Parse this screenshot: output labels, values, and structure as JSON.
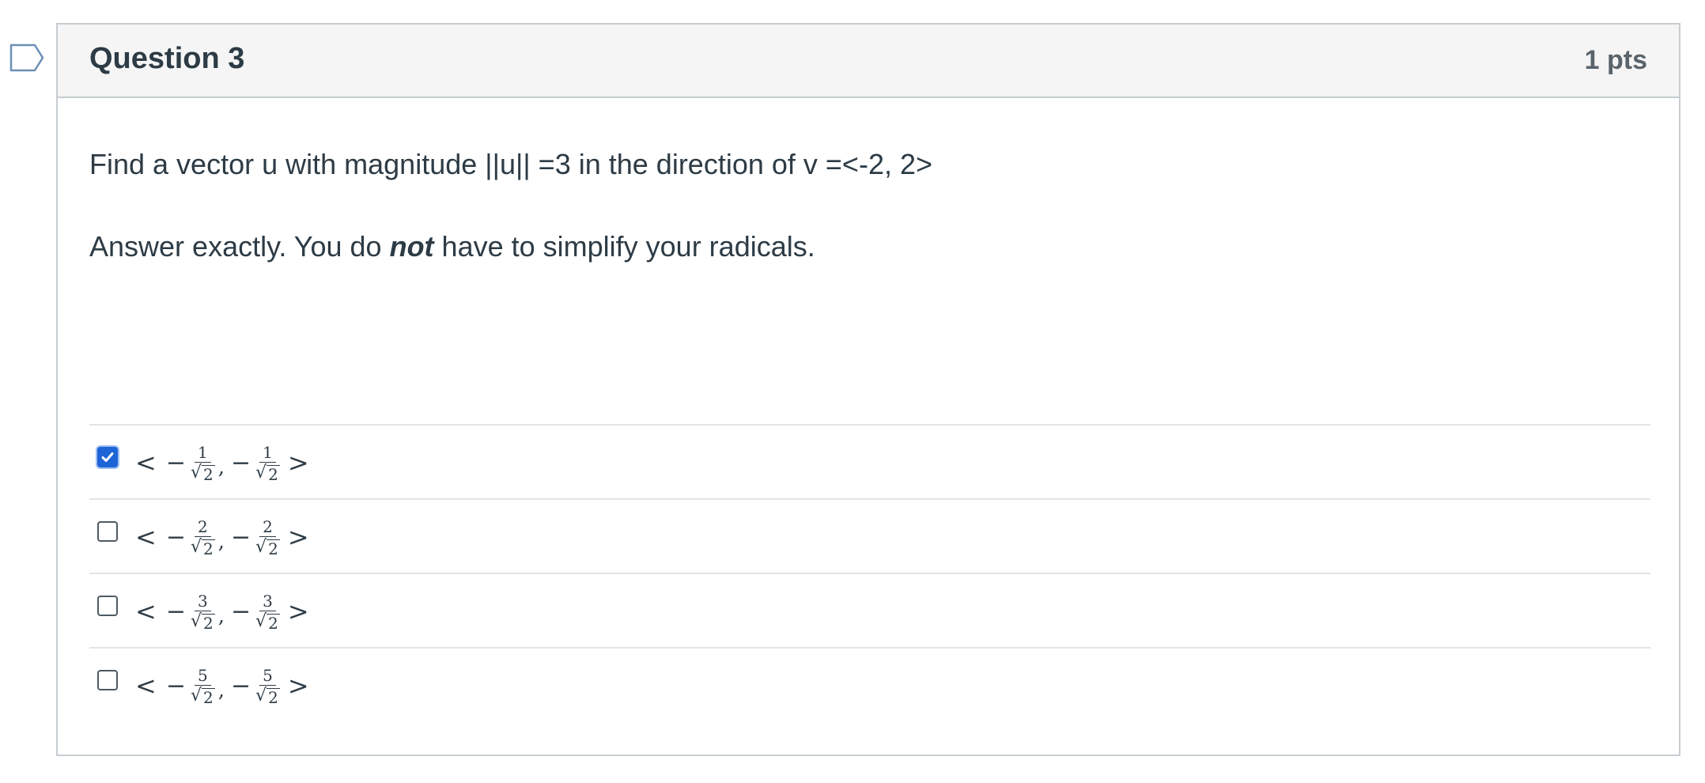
{
  "question": {
    "title": "Question 3",
    "points": "1 pts",
    "prompt_line": "Find a vector u with magnitude ||u|| =3 in the direction of v =<-2, 2>",
    "instruction_before": "Answer exactly. You do ",
    "instruction_emphasis": "not",
    "instruction_after": " have to simplify your radicals."
  },
  "answers": [
    {
      "open": "<",
      "num1": "1",
      "den1": "2",
      "num2": "1",
      "den2": "2",
      "close": ">",
      "checked": true
    },
    {
      "open": "<",
      "num1": "2",
      "den1": "2",
      "num2": "2",
      "den2": "2",
      "close": ">",
      "checked": false
    },
    {
      "open": "<",
      "num1": "3",
      "den1": "2",
      "num2": "3",
      "den2": "2",
      "close": ">",
      "checked": false
    },
    {
      "open": "<",
      "num1": "5",
      "den1": "2",
      "num2": "5",
      "den2": "2",
      "close": ">",
      "checked": false
    }
  ],
  "colors": {
    "accent": "#1d64d7",
    "header_bg": "#f5f5f5",
    "border": "#c7cdd1",
    "text": "#2d3b45"
  },
  "icons": {
    "bookmark": "bookmark-flag-icon",
    "check": "checkmark-icon"
  }
}
